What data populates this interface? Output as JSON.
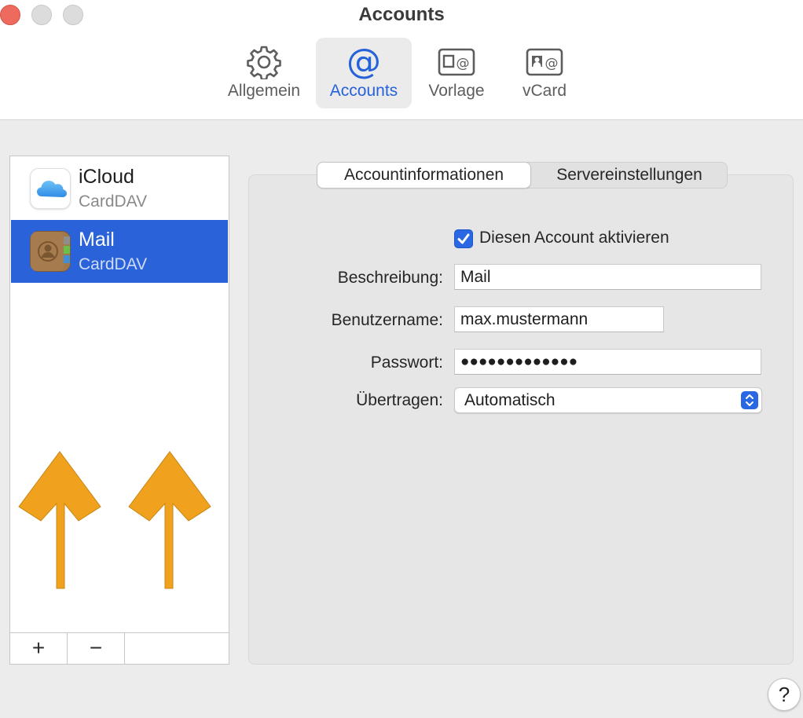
{
  "window": {
    "title": "Accounts",
    "traffic_lights": [
      "close",
      "minimize",
      "zoom"
    ]
  },
  "toolbar": {
    "items": [
      {
        "label": "Allgemein",
        "icon": "gear-icon",
        "selected": false
      },
      {
        "label": "Accounts",
        "icon": "at-sign-icon",
        "selected": true
      },
      {
        "label": "Vorlage",
        "icon": "template-icon",
        "selected": false
      },
      {
        "label": "vCard",
        "icon": "vcard-icon",
        "selected": false
      }
    ]
  },
  "accounts": {
    "items": [
      {
        "name": "iCloud",
        "type": "CardDAV",
        "icon": "icloud-icon",
        "selected": false
      },
      {
        "name": "Mail",
        "type": "CardDAV",
        "icon": "contacts-book-icon",
        "selected": true
      }
    ],
    "add_label": "+",
    "remove_label": "−"
  },
  "annotation": {
    "arrows": 2,
    "color": "#f0a21f"
  },
  "detail": {
    "tabs": [
      {
        "label": "Accountinformationen",
        "selected": true
      },
      {
        "label": "Servereinstellungen",
        "selected": false
      }
    ],
    "enable_checkbox": {
      "label": "Diesen Account aktivieren",
      "checked": true
    },
    "fields": {
      "description": {
        "label": "Beschreibung:",
        "value": "Mail"
      },
      "username": {
        "label": "Benutzername:",
        "value": "max.mustermann"
      },
      "password": {
        "label": "Passwort:",
        "value": "●●●●●●●●●●●●●"
      },
      "transfer": {
        "label": "Übertragen:",
        "value": "Automatisch"
      }
    }
  },
  "help": {
    "label": "?"
  },
  "colors": {
    "accent": "#2a67e3",
    "selection": "#2a62d9",
    "close": "#ec6a5e",
    "arrow": "#f0a21f"
  }
}
